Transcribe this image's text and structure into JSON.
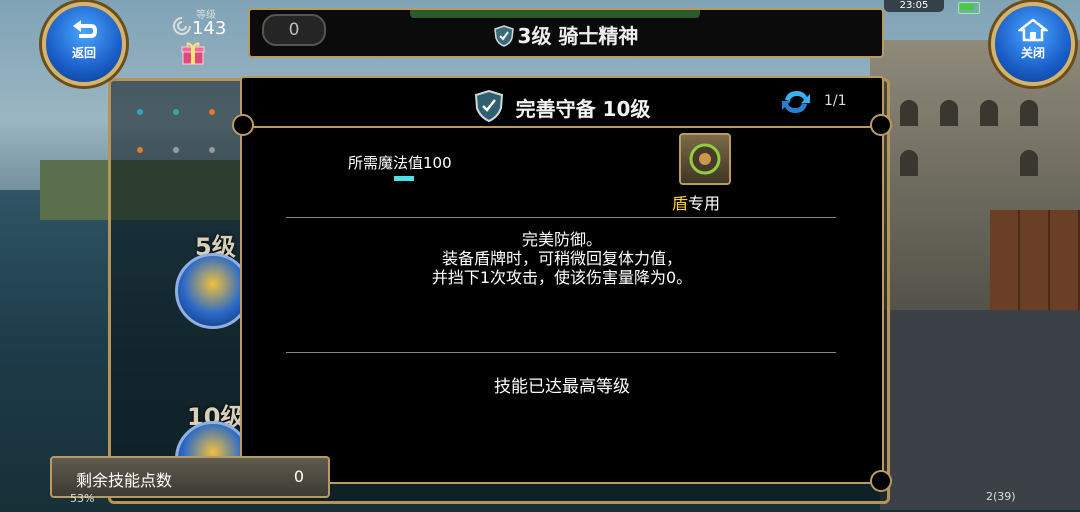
{
  "nav": {
    "back_label": "返回",
    "close_label": "关闭"
  },
  "player": {
    "level_caption": "等级",
    "level_value": "143"
  },
  "status": {
    "clock": "23:05"
  },
  "top_bar": {
    "title": "3级 骑士精神",
    "zero_value": "0"
  },
  "tree": {
    "tier5_label": "5级",
    "tier10_label": "10级"
  },
  "popup": {
    "skill_name": "完善守备 10级",
    "page_indicator": "1/1",
    "mp_requirement": "所需魔法值100",
    "weapon_highlight": "盾",
    "weapon_suffix": "专用",
    "description": [
      "完美防御。",
      "装备盾牌时，可稍微回复体力值，",
      "并挡下1次攻击，使该伤害量降为0。"
    ],
    "max_level_text": "技能已达最高等级"
  },
  "skill_points": {
    "label": "剩余技能点数",
    "value": "0"
  },
  "bottom": {
    "left_stat": "53%",
    "right_stat": "2(39)"
  },
  "colors": {
    "gold_border": "#b89a62",
    "mp_cyan": "#4fe0e8",
    "weapon_yellow": "#ffd23a"
  },
  "icons": [
    "back-arrow-icon",
    "home-icon",
    "shield-icon",
    "refresh-icon",
    "gift-icon",
    "shield-weapon-icon"
  ]
}
